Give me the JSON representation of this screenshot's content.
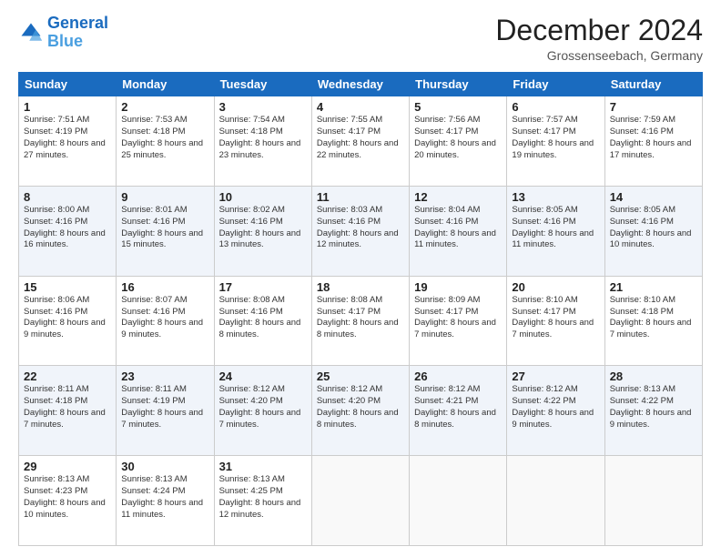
{
  "header": {
    "logo_line1": "General",
    "logo_line2": "Blue",
    "month": "December 2024",
    "location": "Grossenseebach, Germany"
  },
  "weekdays": [
    "Sunday",
    "Monday",
    "Tuesday",
    "Wednesday",
    "Thursday",
    "Friday",
    "Saturday"
  ],
  "weeks": [
    [
      {
        "day": "1",
        "sunrise": "7:51 AM",
        "sunset": "4:19 PM",
        "daylight": "8 hours and 27 minutes."
      },
      {
        "day": "2",
        "sunrise": "7:53 AM",
        "sunset": "4:18 PM",
        "daylight": "8 hours and 25 minutes."
      },
      {
        "day": "3",
        "sunrise": "7:54 AM",
        "sunset": "4:18 PM",
        "daylight": "8 hours and 23 minutes."
      },
      {
        "day": "4",
        "sunrise": "7:55 AM",
        "sunset": "4:17 PM",
        "daylight": "8 hours and 22 minutes."
      },
      {
        "day": "5",
        "sunrise": "7:56 AM",
        "sunset": "4:17 PM",
        "daylight": "8 hours and 20 minutes."
      },
      {
        "day": "6",
        "sunrise": "7:57 AM",
        "sunset": "4:17 PM",
        "daylight": "8 hours and 19 minutes."
      },
      {
        "day": "7",
        "sunrise": "7:59 AM",
        "sunset": "4:16 PM",
        "daylight": "8 hours and 17 minutes."
      }
    ],
    [
      {
        "day": "8",
        "sunrise": "8:00 AM",
        "sunset": "4:16 PM",
        "daylight": "8 hours and 16 minutes."
      },
      {
        "day": "9",
        "sunrise": "8:01 AM",
        "sunset": "4:16 PM",
        "daylight": "8 hours and 15 minutes."
      },
      {
        "day": "10",
        "sunrise": "8:02 AM",
        "sunset": "4:16 PM",
        "daylight": "8 hours and 13 minutes."
      },
      {
        "day": "11",
        "sunrise": "8:03 AM",
        "sunset": "4:16 PM",
        "daylight": "8 hours and 12 minutes."
      },
      {
        "day": "12",
        "sunrise": "8:04 AM",
        "sunset": "4:16 PM",
        "daylight": "8 hours and 11 minutes."
      },
      {
        "day": "13",
        "sunrise": "8:05 AM",
        "sunset": "4:16 PM",
        "daylight": "8 hours and 11 minutes."
      },
      {
        "day": "14",
        "sunrise": "8:05 AM",
        "sunset": "4:16 PM",
        "daylight": "8 hours and 10 minutes."
      }
    ],
    [
      {
        "day": "15",
        "sunrise": "8:06 AM",
        "sunset": "4:16 PM",
        "daylight": "8 hours and 9 minutes."
      },
      {
        "day": "16",
        "sunrise": "8:07 AM",
        "sunset": "4:16 PM",
        "daylight": "8 hours and 9 minutes."
      },
      {
        "day": "17",
        "sunrise": "8:08 AM",
        "sunset": "4:16 PM",
        "daylight": "8 hours and 8 minutes."
      },
      {
        "day": "18",
        "sunrise": "8:08 AM",
        "sunset": "4:17 PM",
        "daylight": "8 hours and 8 minutes."
      },
      {
        "day": "19",
        "sunrise": "8:09 AM",
        "sunset": "4:17 PM",
        "daylight": "8 hours and 7 minutes."
      },
      {
        "day": "20",
        "sunrise": "8:10 AM",
        "sunset": "4:17 PM",
        "daylight": "8 hours and 7 minutes."
      },
      {
        "day": "21",
        "sunrise": "8:10 AM",
        "sunset": "4:18 PM",
        "daylight": "8 hours and 7 minutes."
      }
    ],
    [
      {
        "day": "22",
        "sunrise": "8:11 AM",
        "sunset": "4:18 PM",
        "daylight": "8 hours and 7 minutes."
      },
      {
        "day": "23",
        "sunrise": "8:11 AM",
        "sunset": "4:19 PM",
        "daylight": "8 hours and 7 minutes."
      },
      {
        "day": "24",
        "sunrise": "8:12 AM",
        "sunset": "4:20 PM",
        "daylight": "8 hours and 7 minutes."
      },
      {
        "day": "25",
        "sunrise": "8:12 AM",
        "sunset": "4:20 PM",
        "daylight": "8 hours and 8 minutes."
      },
      {
        "day": "26",
        "sunrise": "8:12 AM",
        "sunset": "4:21 PM",
        "daylight": "8 hours and 8 minutes."
      },
      {
        "day": "27",
        "sunrise": "8:12 AM",
        "sunset": "4:22 PM",
        "daylight": "8 hours and 9 minutes."
      },
      {
        "day": "28",
        "sunrise": "8:13 AM",
        "sunset": "4:22 PM",
        "daylight": "8 hours and 9 minutes."
      }
    ],
    [
      {
        "day": "29",
        "sunrise": "8:13 AM",
        "sunset": "4:23 PM",
        "daylight": "8 hours and 10 minutes."
      },
      {
        "day": "30",
        "sunrise": "8:13 AM",
        "sunset": "4:24 PM",
        "daylight": "8 hours and 11 minutes."
      },
      {
        "day": "31",
        "sunrise": "8:13 AM",
        "sunset": "4:25 PM",
        "daylight": "8 hours and 12 minutes."
      },
      null,
      null,
      null,
      null
    ]
  ]
}
